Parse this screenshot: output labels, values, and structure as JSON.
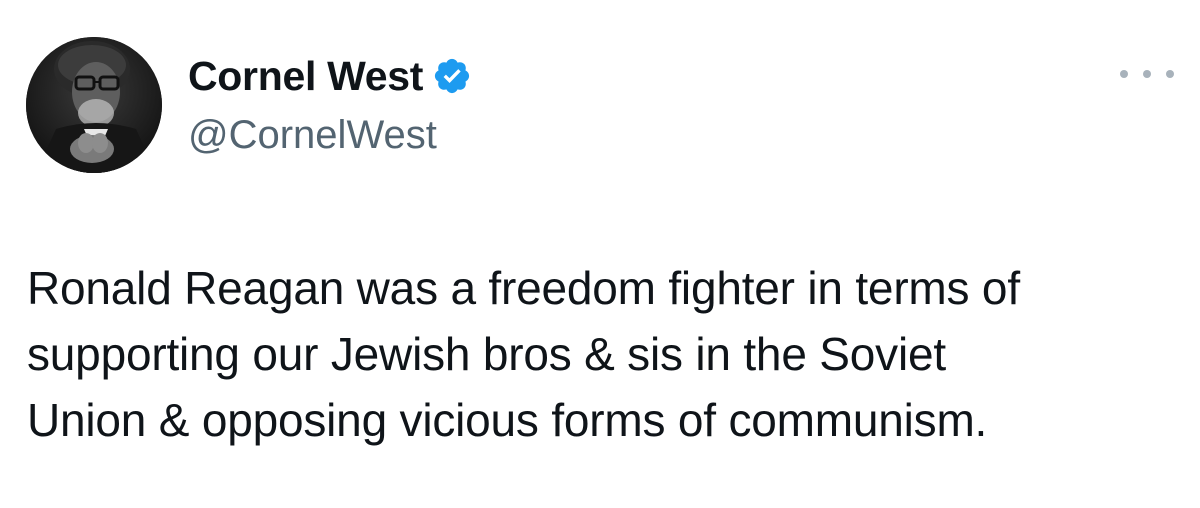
{
  "tweet": {
    "author": {
      "display_name": "Cornel West",
      "handle": "@CornelWest",
      "verified": true
    },
    "text": "Ronald Reagan was a freedom fighter in terms of\nsupporting our Jewish bros & sis in the Soviet\nUnion & opposing vicious forms of communism."
  },
  "icons": {
    "verified": "verified-badge-icon",
    "more": "more-options-icon"
  },
  "colors": {
    "text_primary": "#0f1419",
    "text_secondary": "#536471",
    "verified_blue": "#1d9bf0",
    "more_dots": "#a8b2bb",
    "background": "#ffffff"
  }
}
